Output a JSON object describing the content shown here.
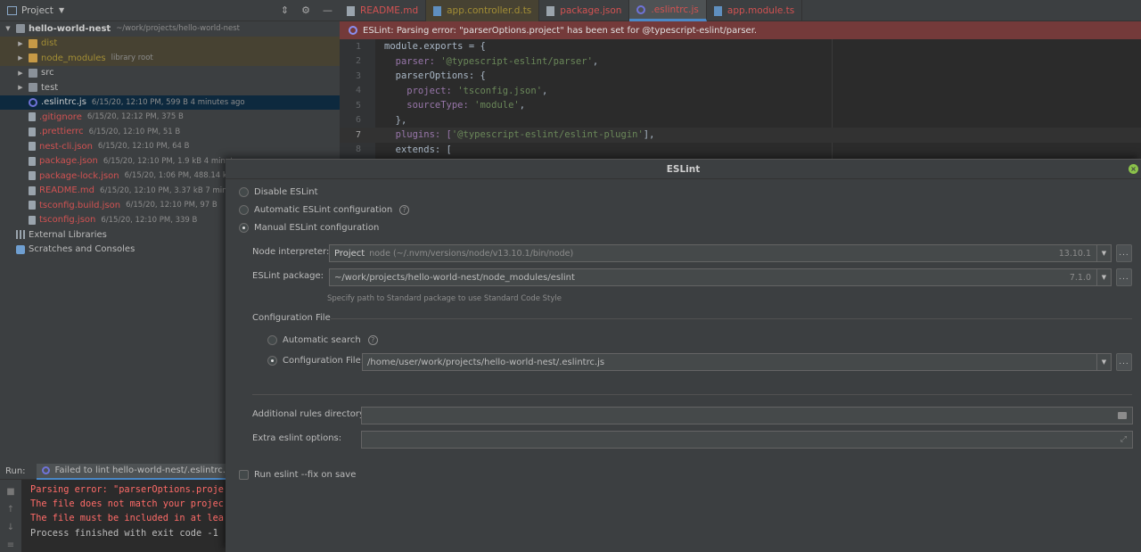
{
  "project": {
    "title": "Project",
    "root": {
      "name": "hello-world-nest",
      "path": "~/work/projects/hello-world-nest"
    },
    "folders": [
      {
        "name": "dist",
        "meta": ""
      },
      {
        "name": "node_modules",
        "meta": "library root"
      },
      {
        "name": "src",
        "meta": ""
      },
      {
        "name": "test",
        "meta": ""
      }
    ],
    "files": [
      {
        "name": ".eslintrc.js",
        "meta": "6/15/20, 12:10 PM, 599 B 4 minutes ago"
      },
      {
        "name": ".gitignore",
        "meta": "6/15/20, 12:12 PM, 375 B"
      },
      {
        "name": ".prettierrc",
        "meta": "6/15/20, 12:10 PM, 51 B"
      },
      {
        "name": "nest-cli.json",
        "meta": "6/15/20, 12:10 PM, 64 B"
      },
      {
        "name": "package.json",
        "meta": "6/15/20, 12:10 PM, 1.9 kB 4 minutes"
      },
      {
        "name": "package-lock.json",
        "meta": "6/15/20, 1:06 PM, 488.14 kB"
      },
      {
        "name": "README.md",
        "meta": "6/15/20, 12:10 PM, 3.37 kB 7 minute"
      },
      {
        "name": "tsconfig.build.json",
        "meta": "6/15/20, 12:10 PM, 97 B"
      },
      {
        "name": "tsconfig.json",
        "meta": "6/15/20, 12:10 PM, 339 B"
      }
    ],
    "external_libraries": "External Libraries",
    "scratches": "Scratches and Consoles"
  },
  "tabs": [
    "README.md",
    "app.controller.d.ts",
    "package.json",
    ".eslintrc.js",
    "app.module.ts"
  ],
  "error_banner": "ESLint: Parsing error: \"parserOptions.project\" has been set for @typescript-eslint/parser.",
  "code": {
    "line_numbers": [
      "1",
      "2",
      "3",
      "4",
      "5",
      "6",
      "7",
      "8"
    ],
    "l1": "module.exports = {",
    "l2_key": "  parser: ",
    "l2_val": "'@typescript-eslint/parser'",
    "l2_end": ",",
    "l3": "  parserOptions: {",
    "l4_key": "    project: ",
    "l4_val": "'tsconfig.json'",
    "l4_end": ",",
    "l5_key": "    sourceType: ",
    "l5_val": "'module'",
    "l5_end": ",",
    "l6": "  },",
    "l7_key": "  plugins: [",
    "l7_val": "'@typescript-eslint/eslint-plugin'",
    "l7_end": "],",
    "l8": "  extends: ["
  },
  "run": {
    "label": "Run:",
    "tab": "Failed to lint hello-world-nest/.eslintrc.js",
    "lines": [
      "Parsing error: \"parserOptions.proje",
      "The file does not match your projec",
      "The file must be included in at lea",
      "Process finished with exit code -1"
    ]
  },
  "dialog": {
    "title": "ESLint",
    "disable": "Disable ESLint",
    "automatic": "Automatic ESLint configuration",
    "manual": "Manual ESLint configuration",
    "node_label": "Node interpreter:",
    "node_project": "Project",
    "node_path": "node (~/.nvm/versions/node/v13.10.1/bin/node)",
    "node_version": "13.10.1",
    "pkg_label": "ESLint package:",
    "pkg_path": "~/work/projects/hello-world-nest/node_modules/eslint",
    "pkg_version": "7.1.0",
    "pkg_hint": "Specify path to Standard package to use Standard Code Style",
    "config_section": "Configuration File",
    "auto_search": "Automatic search",
    "config_file_label": "Configuration File:",
    "config_file_path": "/home/user/work/projects/hello-world-nest/.eslintrc.js",
    "rules_label": "Additional rules directory:",
    "options_label": "Extra eslint options:",
    "fix_on_save": "Run eslint --fix on save",
    "browse": "..."
  }
}
